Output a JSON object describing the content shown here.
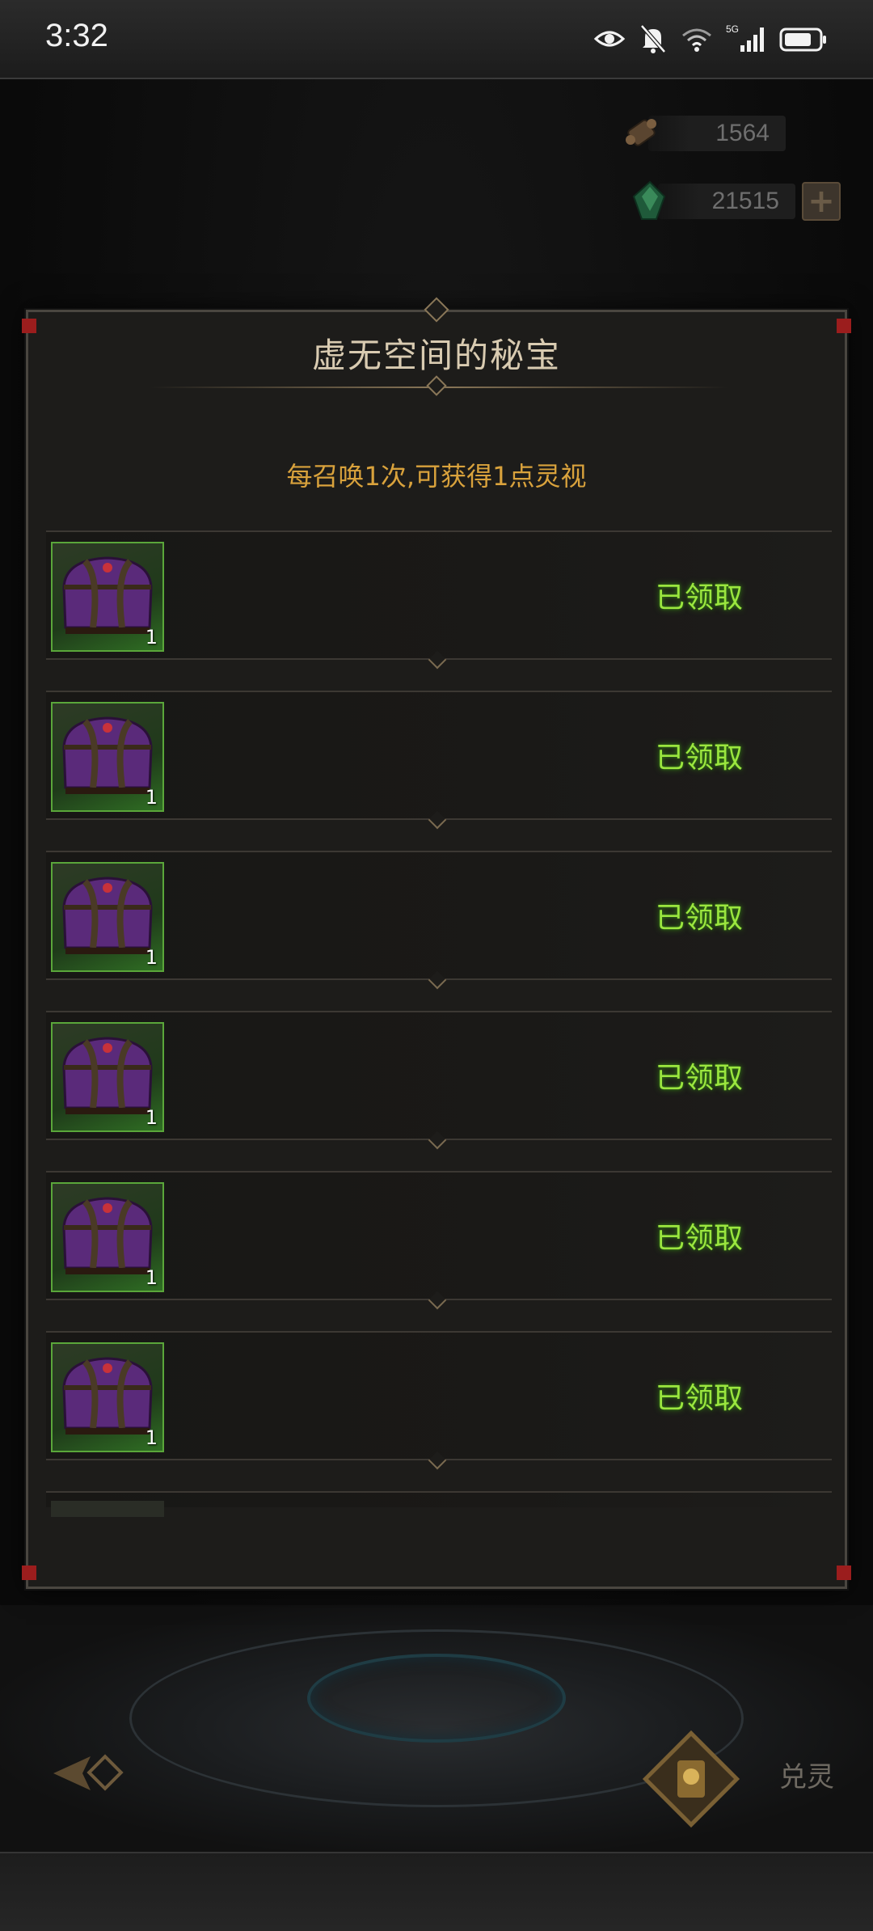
{
  "status_bar": {
    "time": "3:32",
    "icons": [
      "eye-icon",
      "bell-muted-icon",
      "wifi-icon",
      "signal-5g-icon",
      "battery-icon"
    ],
    "network_label": "5G"
  },
  "currencies": [
    {
      "icon": "scroll-icon",
      "value": "1564"
    },
    {
      "icon": "green-gem-icon",
      "value": "21515",
      "has_add_button": true
    }
  ],
  "dialog": {
    "title": "虚无空间的秘宝",
    "subtitle": "每召唤1次,可获得1点灵视",
    "rewards": [
      {
        "icon": "purple-chest-icon",
        "count": "1",
        "status": "已领取"
      },
      {
        "icon": "purple-chest-icon",
        "count": "1",
        "status": "已领取"
      },
      {
        "icon": "purple-chest-icon",
        "count": "1",
        "status": "已领取"
      },
      {
        "icon": "purple-chest-icon",
        "count": "1",
        "status": "已领取"
      },
      {
        "icon": "purple-chest-icon",
        "count": "1",
        "status": "已领取"
      },
      {
        "icon": "purple-chest-icon",
        "count": "1",
        "status": "已领取"
      }
    ]
  },
  "bottom_bar": {
    "back_icon": "back-arrow-icon",
    "exchange_label": "兑灵"
  },
  "colors": {
    "claimed_text": "#9be63f",
    "subtitle_text": "#d9a23c",
    "title_text": "#d9cbb1",
    "item_frame": "#5aa63a",
    "corner_accent": "#9b1d1d"
  }
}
